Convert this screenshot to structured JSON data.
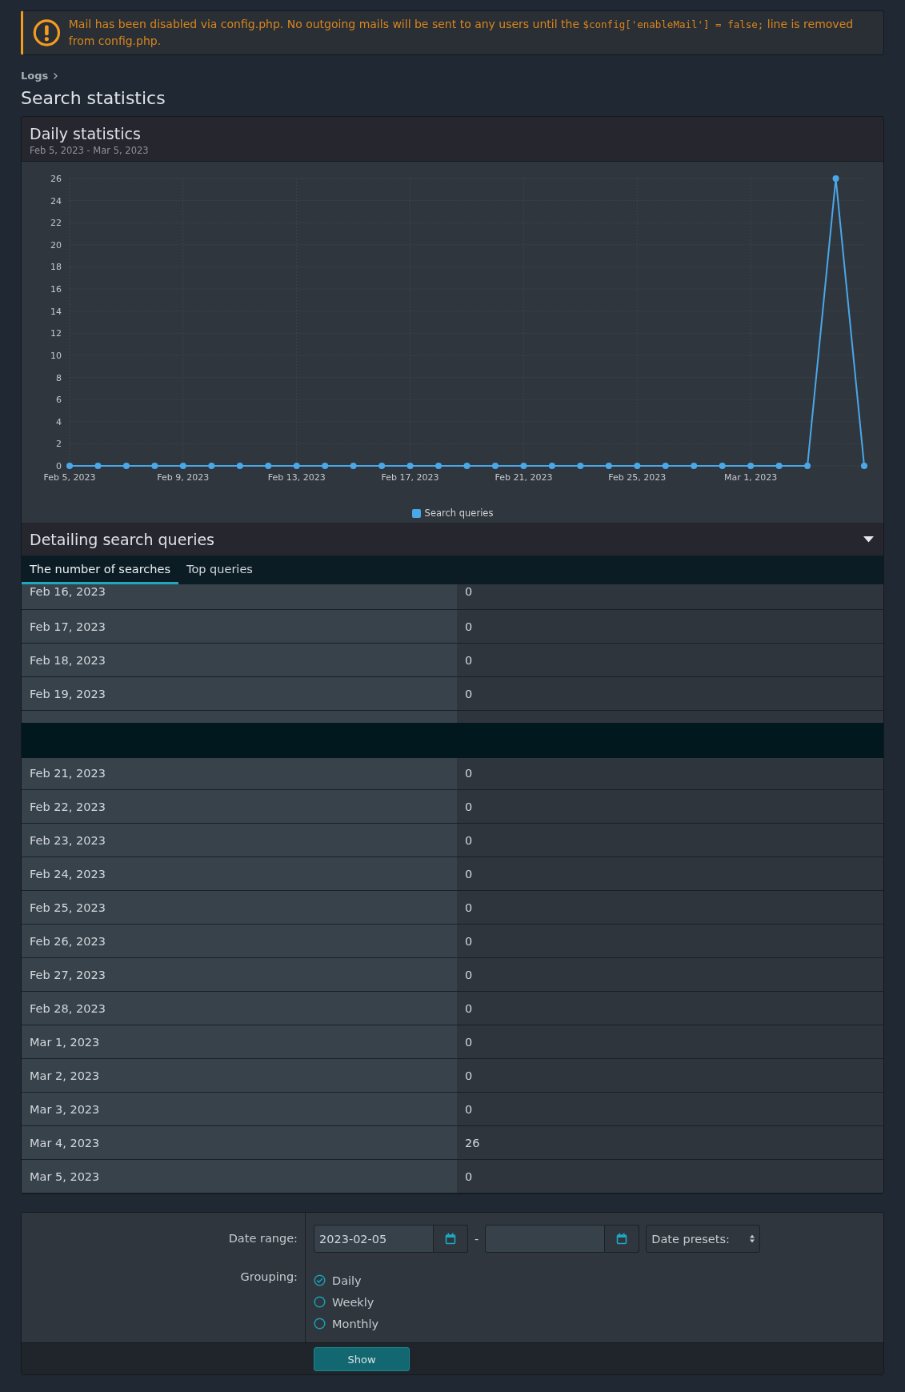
{
  "notice": {
    "text_before": "Mail has been disabled via config.php. No outgoing mails will be sent to any users until the",
    "code": "$config['enableMail'] = false;",
    "text_after": "line is removed from config.php."
  },
  "breadcrumb": [
    "Logs"
  ],
  "page_title": "Search statistics",
  "chart_card": {
    "title": "Daily statistics",
    "subtitle": "Feb 5, 2023 - Mar 5, 2023",
    "chart_data": {
      "type": "line",
      "grid": true,
      "categories": [
        "Feb 5, 2023",
        null,
        null,
        null,
        "Feb 9, 2023",
        null,
        null,
        null,
        "Feb 13, 2023",
        null,
        null,
        null,
        "Feb 17, 2023",
        null,
        null,
        null,
        "Feb 21, 2023",
        null,
        null,
        null,
        "Feb 25, 2023",
        null,
        null,
        null,
        "Mar 1, 2023",
        null,
        null,
        null,
        null
      ],
      "ylim": [
        0,
        26
      ],
      "yticks": [
        0,
        2,
        4,
        6,
        8,
        10,
        12,
        14,
        16,
        18,
        20,
        22,
        24,
        26
      ],
      "series": [
        {
          "name": "Search queries",
          "color": "#4aa8e8",
          "marker": "circle",
          "values": [
            0,
            0,
            0,
            0,
            0,
            0,
            0,
            0,
            0,
            0,
            0,
            0,
            0,
            0,
            0,
            0,
            0,
            0,
            0,
            0,
            0,
            0,
            0,
            0,
            0,
            0,
            0,
            26,
            0
          ]
        }
      ]
    }
  },
  "detail": {
    "title": "Detailing search queries",
    "tabs": [
      {
        "label": "The number of searches",
        "selected": true
      },
      {
        "label": "Top queries",
        "selected": false
      }
    ],
    "rows": [
      {
        "date": "Feb 16, 2023",
        "count": "0"
      },
      {
        "date": "Feb 17, 2023",
        "count": "0"
      },
      {
        "date": "Feb 18, 2023",
        "count": "0"
      },
      {
        "date": "Feb 19, 2023",
        "count": "0"
      },
      {
        "kind": "covered"
      },
      {
        "date": "Feb 21, 2023",
        "count": "0"
      },
      {
        "date": "Feb 22, 2023",
        "count": "0"
      },
      {
        "date": "Feb 23, 2023",
        "count": "0"
      },
      {
        "date": "Feb 24, 2023",
        "count": "0"
      },
      {
        "date": "Feb 25, 2023",
        "count": "0"
      },
      {
        "date": "Feb 26, 2023",
        "count": "0"
      },
      {
        "date": "Feb 27, 2023",
        "count": "0"
      },
      {
        "date": "Feb 28, 2023",
        "count": "0"
      },
      {
        "date": "Mar 1, 2023",
        "count": "0"
      },
      {
        "date": "Mar 2, 2023",
        "count": "0"
      },
      {
        "date": "Mar 3, 2023",
        "count": "0"
      },
      {
        "date": "Mar 4, 2023",
        "count": "26"
      },
      {
        "date": "Mar 5, 2023",
        "count": "0"
      }
    ]
  },
  "form": {
    "date_range_label": "Date range:",
    "start_date": "2023-02-05",
    "separator": "-",
    "presets": "Date presets:",
    "grouping_label": "Grouping:",
    "grouping": [
      {
        "label": "Daily",
        "selected": true
      },
      {
        "label": "Weekly",
        "selected": false
      },
      {
        "label": "Monthly",
        "selected": false
      }
    ],
    "submit": "Show"
  }
}
